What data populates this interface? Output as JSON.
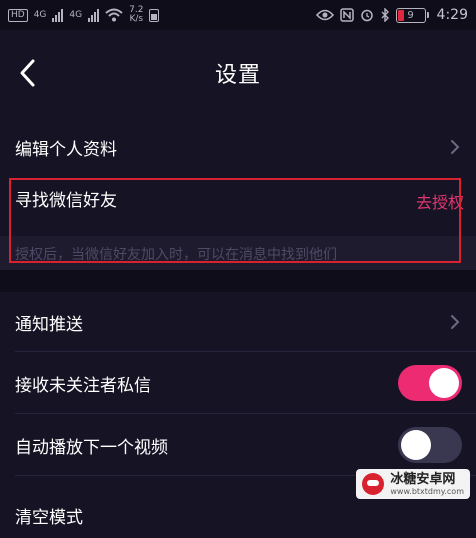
{
  "status_bar": {
    "hd": "HD",
    "net_1": "4G",
    "net_2": "4G",
    "speed": "7.2",
    "speed_unit": "K/s",
    "battery_level": "9",
    "time": "4:29"
  },
  "header": {
    "title": "设置",
    "back_icon": "chevron-left-icon"
  },
  "rows": {
    "edit_profile": "编辑个人资料",
    "find_wechat": "寻找微信好友",
    "auth_button": "去授权",
    "wechat_hint": "授权后，当微信好友加入时，可以在消息中找到他们",
    "notifications": "通知推送",
    "stranger_messages": "接收未关注者私信",
    "autoplay": "自动播放下一个视频",
    "clear_mode": "清空模式"
  },
  "toggles": {
    "stranger_messages_on": true,
    "autoplay_on": false
  },
  "colors": {
    "accent": "#ec2b73",
    "highlight_box": "#d9222f",
    "background": "#161424"
  },
  "watermark": {
    "name": "冰糖安卓网",
    "url": "www.btxtdmy.com"
  }
}
